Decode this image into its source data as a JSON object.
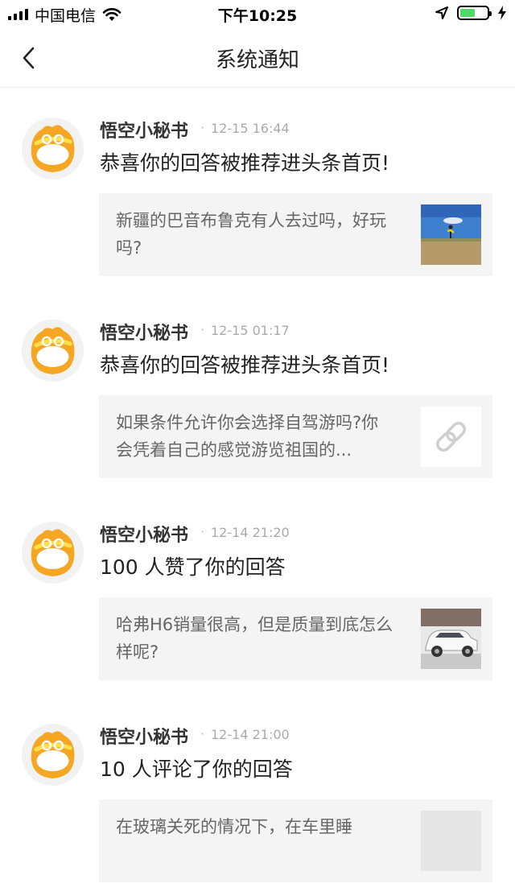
{
  "status_bar": {
    "carrier": "中国电信",
    "time": "下午10:25",
    "battery_level": 0.55
  },
  "nav": {
    "title": "系统通知"
  },
  "notifications": [
    {
      "sender": "悟空小秘书",
      "time": "12-15 16:44",
      "message": "恭喜你的回答被推荐进头条首页!",
      "card_text": "新疆的巴音布鲁克有人去过吗，好玩吗?",
      "thumb": "photo-grassland"
    },
    {
      "sender": "悟空小秘书",
      "time": "12-15 01:17",
      "message": "恭喜你的回答被推荐进头条首页!",
      "card_text": "如果条件允许你会选择自驾游吗?你会凭着自己的感觉游览祖国的...",
      "thumb": "link-icon"
    },
    {
      "sender": "悟空小秘书",
      "time": "12-14 21:20",
      "message": "100 人赞了你的回答",
      "card_text": "哈弗H6销量很高，但是质量到底怎么样呢?",
      "thumb": "photo-white-suv"
    },
    {
      "sender": "悟空小秘书",
      "time": "12-14 21:00",
      "message": "10 人评论了你的回答",
      "card_text": "在玻璃关死的情况下，在车里睡",
      "thumb": "photo"
    }
  ],
  "colors": {
    "avatar_orange": "#f5a623",
    "battery_green": "#4cd964",
    "card_bg": "#f4f4f4"
  }
}
